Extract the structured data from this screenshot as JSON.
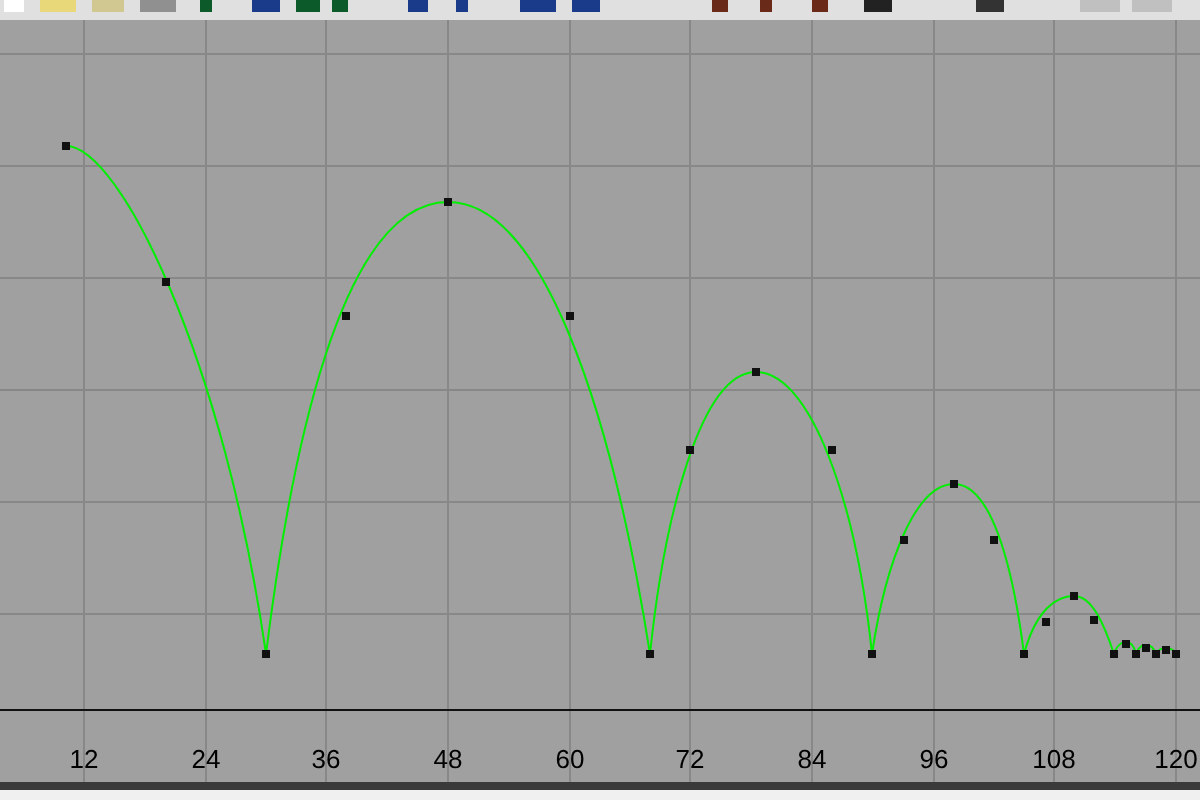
{
  "graph": {
    "frame_labels": [
      "12",
      "24",
      "36",
      "48",
      "60",
      "72",
      "84",
      "96",
      "108",
      "120"
    ]
  }
}
